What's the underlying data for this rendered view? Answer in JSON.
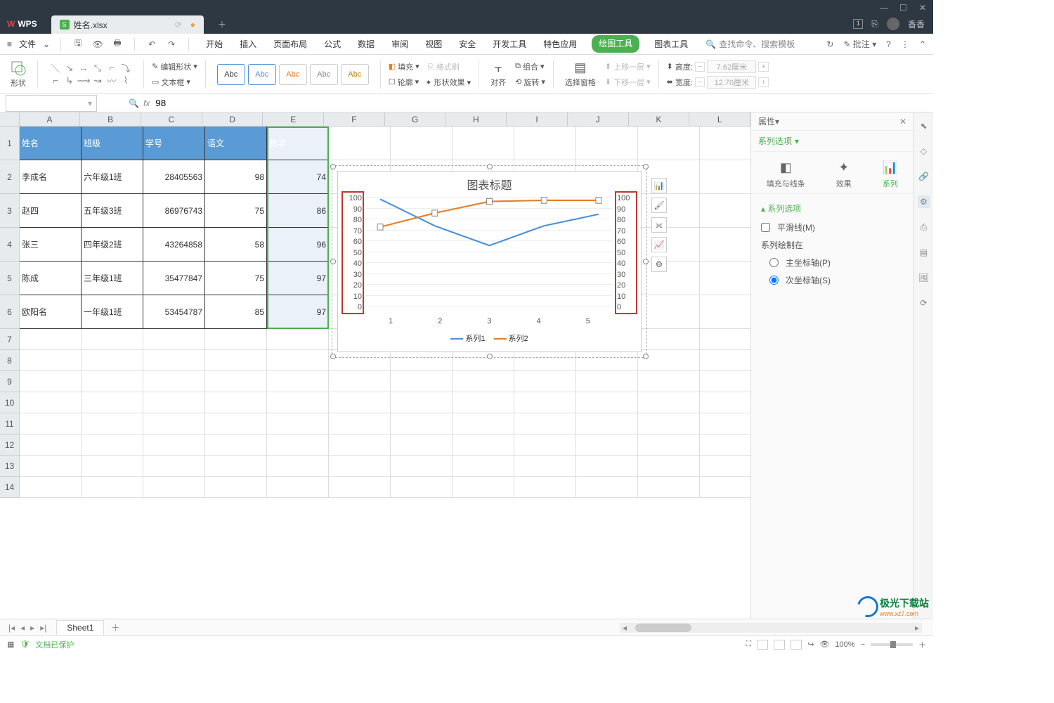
{
  "app": {
    "name": "WPS",
    "file_tab": "姓名.xlsx",
    "user": "香香"
  },
  "menu": {
    "file": "文件",
    "items": [
      "开始",
      "插入",
      "页面布局",
      "公式",
      "数据",
      "审阅",
      "视图",
      "安全",
      "开发工具",
      "特色应用",
      "绘图工具",
      "图表工具"
    ],
    "active_index": 10,
    "search_placeholder": "查找命令、搜索模板",
    "批注": "批注"
  },
  "ribbon": {
    "shape_label": "形状",
    "edit_shape": "编辑形状",
    "text_box": "文本框",
    "abc": "Abc",
    "fill": "填充",
    "format_painter": "格式刷",
    "outline": "轮廓",
    "shape_effect": "形状效果",
    "align": "对齐",
    "group": "组合",
    "rotate": "旋转",
    "select_pane": "选择窗格",
    "move_up": "上移一层",
    "move_down": "下移一层",
    "height": "高度:",
    "width": "宽度:",
    "height_val": "7.62厘米",
    "width_val": "12.70厘米"
  },
  "formula": {
    "name_box": "",
    "fx_value": "98"
  },
  "columns": [
    "A",
    "B",
    "C",
    "D",
    "E",
    "F",
    "G",
    "H",
    "I",
    "J",
    "K",
    "L"
  ],
  "row_count_data": 6,
  "table_headers": [
    "姓名",
    "班级",
    "学号",
    "语文",
    "数学"
  ],
  "table_rows": [
    [
      "李成名",
      "六年级1班",
      "28405563",
      "98",
      "74"
    ],
    [
      "赵四",
      "五年级3班",
      "86976743",
      "75",
      "86"
    ],
    [
      "张三",
      "四年级2班",
      "43264858",
      "58",
      "96"
    ],
    [
      "陈成",
      "三年级1班",
      "35477847",
      "75",
      "97"
    ],
    [
      "欧阳名",
      "一年级1班",
      "53454787",
      "85",
      "97"
    ]
  ],
  "chart_data": {
    "type": "line",
    "title": "图表标题",
    "categories": [
      "1",
      "2",
      "3",
      "4",
      "5"
    ],
    "series": [
      {
        "name": "系列1",
        "values": [
          98,
          75,
          58,
          75,
          85
        ],
        "color": "#4a90d9"
      },
      {
        "name": "系列2",
        "values": [
          74,
          86,
          96,
          97,
          97
        ],
        "color": "#e67e22",
        "selected": true
      }
    ],
    "y_ticks_left": [
      100,
      90,
      80,
      70,
      60,
      50,
      40,
      30,
      20,
      10,
      0
    ],
    "y_ticks_right": [
      100,
      90,
      80,
      70,
      60,
      50,
      40,
      30,
      20,
      10,
      0
    ],
    "ylim": [
      0,
      100
    ]
  },
  "props": {
    "title": "属性",
    "tab": "系列选项",
    "icon_tabs": [
      "填充与线条",
      "效果",
      "系列"
    ],
    "active_icon": 2,
    "section_title": "系列选项",
    "smooth_line": "平滑线(M)",
    "plot_on": "系列绘制在",
    "primary_axis": "主坐标轴(P)",
    "secondary_axis": "次坐标轴(S)",
    "selected_axis": "secondary"
  },
  "sheets": {
    "active": "Sheet1"
  },
  "status": {
    "protected": "文档已保护",
    "zoom": "100%"
  }
}
